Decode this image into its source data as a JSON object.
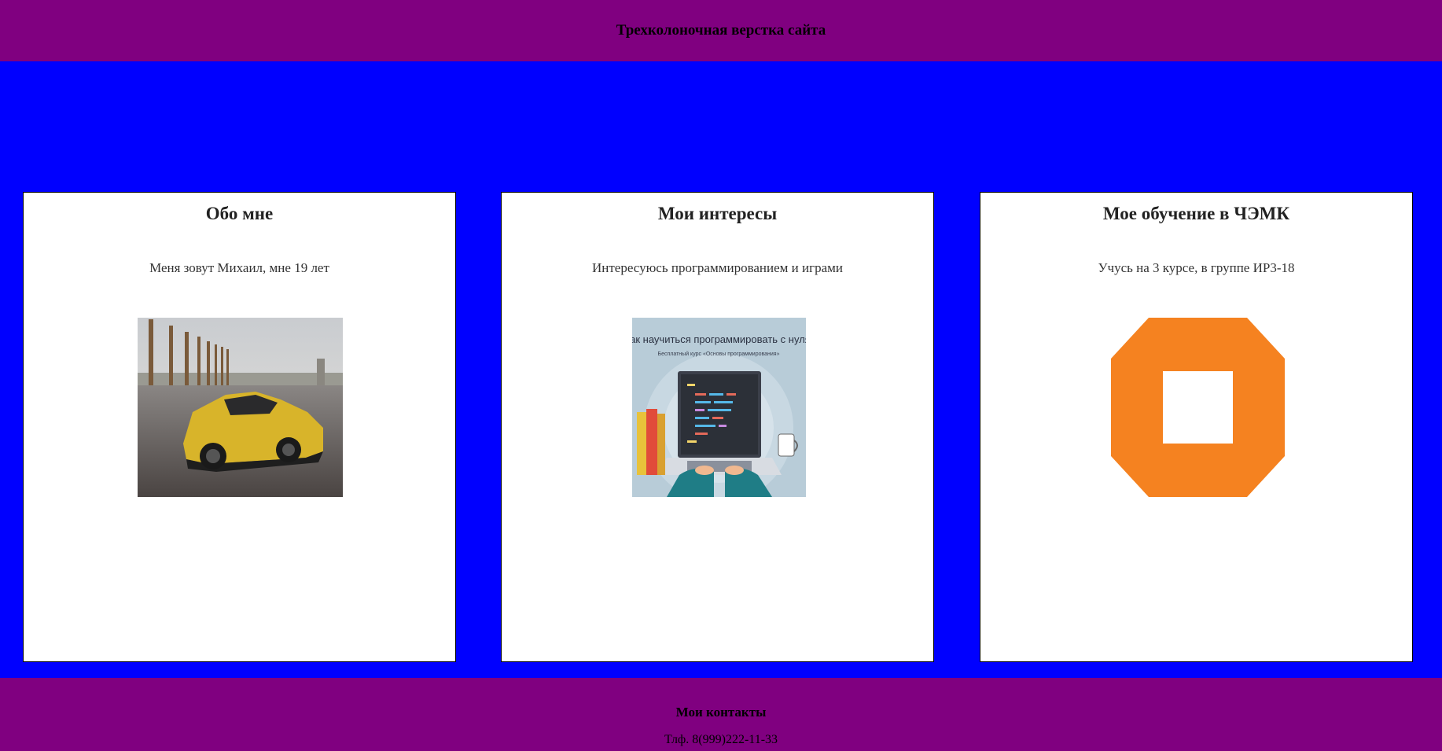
{
  "header": {
    "title": "Трехколоночная верстка сайта"
  },
  "columns": [
    {
      "title": "Обо мне",
      "text": "Меня зовут Михаил, мне 19 лет",
      "image": "yellow-sports-car-photo"
    },
    {
      "title": "Мои интересы",
      "text": "Интересуюсь программированием и играми",
      "image": "programming-course-illustration",
      "image_title": "Как научиться программировать с нуля!",
      "image_subtitle": "Бесплатный курс «Основы программирования»"
    },
    {
      "title": "Мое обучение в ЧЭМК",
      "text": "Учусь на 3 курсе, в группе ИР3-18",
      "image": "orange-octagon-logo"
    }
  ],
  "footer": {
    "title": "Мои контакты",
    "phone": "Тлф. 8(999)222-11-33"
  },
  "colors": {
    "header_bg": "#800080",
    "content_bg": "#0000ff",
    "column_bg": "#ffffff",
    "logo_orange": "#f58220"
  }
}
